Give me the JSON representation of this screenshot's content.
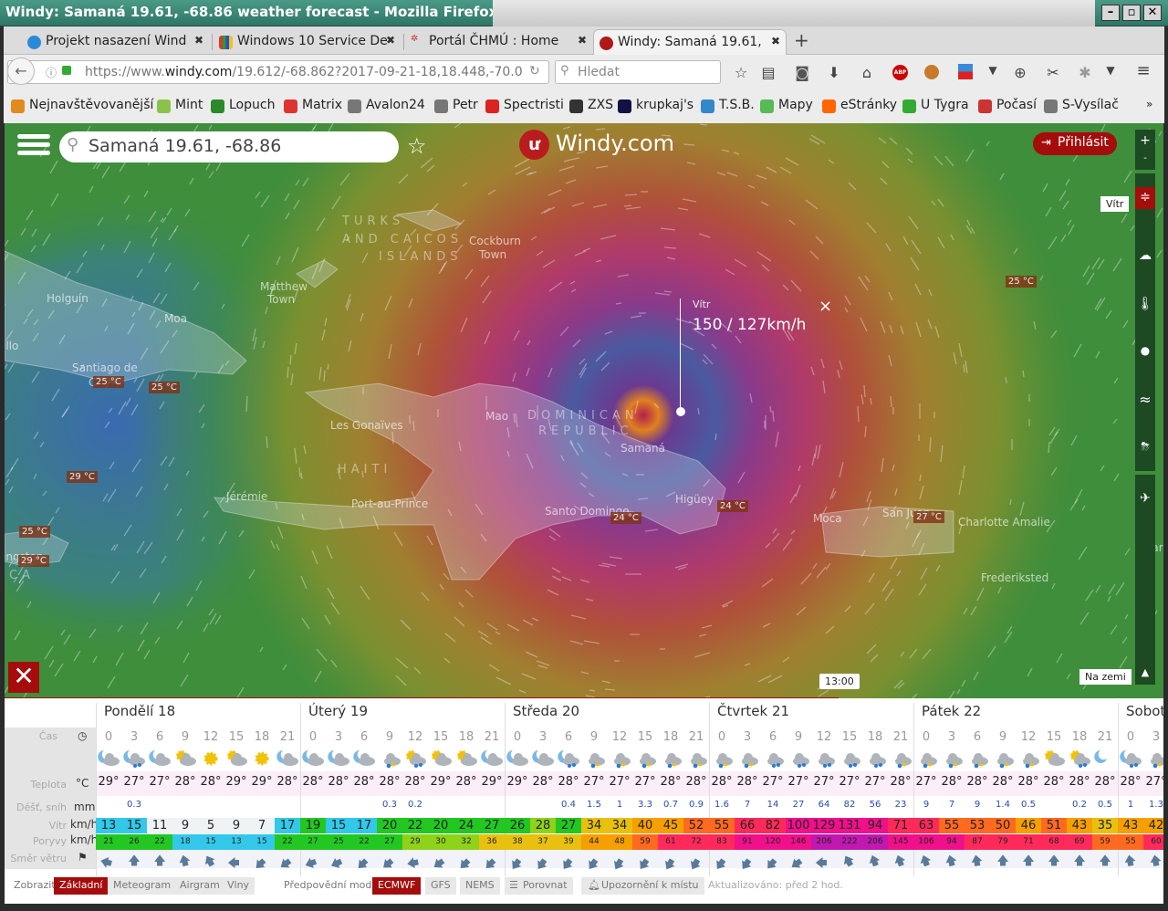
{
  "window": {
    "title": "Windy: Samaná 19.61, -68.86 weather forecast - Mozilla Firefox",
    "minimize": "–",
    "restore": "▫",
    "close": "✕"
  },
  "tabs": [
    {
      "label": "Projekt nasazení Wind",
      "color": "#2a8ad8",
      "active": false
    },
    {
      "label": "Windows 10 Service De",
      "color": "#d83a2a",
      "active": false
    },
    {
      "label": "Portál ČHMÚ : Home",
      "color": "#cc3333",
      "active": false
    },
    {
      "label": "Windy: Samaná 19.61,",
      "color": "#b01818",
      "active": true
    }
  ],
  "new_tab": "+",
  "url": {
    "prefix": "https://www.",
    "domain": "windy.com",
    "path": "/19.612/-68.862?2017-09-21-18,18.448,-70.0"
  },
  "search_placeholder": "Hledat",
  "bookmarks": [
    "Nejnavštěvovanější",
    "Mint",
    "Lopuch",
    "Matrix",
    "Avalon24",
    "Petr",
    "Spectristi",
    "ZXS",
    "krupkaj's",
    "T.S.B.",
    "Mapy",
    "eStránky",
    "U Tygra",
    "Počasí",
    "S-Vysílač"
  ],
  "bookmarks_more": "»",
  "windy": {
    "search_value": "Samaná 19.61, -68.86",
    "logo": "Windy.com",
    "login": "Přihlásit",
    "zoom_in": "+",
    "zoom_out": "-",
    "layer_active": "Vítr",
    "layers": [
      "wind-icon",
      "cloud-icon",
      "thermometer-icon",
      "drop-icon",
      "waves-icon",
      "storm-icon",
      "plane-icon",
      "mountain-icon"
    ],
    "altitude_label": "Na zemi",
    "popup": {
      "title": "Vítr",
      "value": "150 / 127km/h",
      "close": "×"
    },
    "timeline_time": "13:00",
    "timeline_progress": 0.72,
    "accent": "#a50c0c"
  },
  "map": {
    "temps": [
      "25 °C",
      "25 °C",
      "25 °C",
      "29 °C",
      "24 °C",
      "24 °C",
      "27 °C",
      "25 °C",
      "29 °C"
    ],
    "places": [
      "TURKS",
      "AND CAICOS",
      "ISLANDS",
      "Cockburn",
      "Town",
      "Matthew",
      "Town",
      "Holguín",
      "Moa",
      "illo",
      "Santiago de",
      "C",
      "Les Gonaïves",
      "HAITI",
      "Jérémie",
      "Port-au-Prince",
      "Mao",
      "DOMINICAN",
      "REPUBLIC",
      "Samaná",
      "Santo Domingo",
      "Higüey",
      "Moca",
      "San Juan",
      "Charlotte Amalie",
      "Frederiksted",
      "ingston",
      "CA",
      "Mar"
    ]
  },
  "forecast": {
    "row_labels": {
      "time": "Čas",
      "temp": "Teplota",
      "temp_unit": "°C",
      "rain": "Déšť, sníh",
      "rain_unit": "mm",
      "wind": "Vítr",
      "wind_unit": "km/h",
      "gust": "Poryvy",
      "gust_unit": "km/h",
      "dir": "Směr větru"
    },
    "days": [
      {
        "label": "Pondělí 18",
        "hours": [
          "0",
          "3",
          "6",
          "9",
          "12",
          "15",
          "18",
          "21"
        ],
        "icons": [
          "moon-cloud",
          "moon-cloud-rain",
          "moon-cloud",
          "sun-cloud",
          "sun",
          "sun-cloud",
          "sun",
          "moon-cloud"
        ],
        "temps": [
          "29°",
          "27°",
          "27°",
          "28°",
          "28°",
          "29°",
          "29°",
          "28°"
        ],
        "rain": [
          "",
          "0.3",
          "",
          "",
          "",
          "",
          "",
          ""
        ],
        "wind": [
          "13",
          "15",
          "11",
          "9",
          "5",
          "9",
          "7",
          "17"
        ],
        "gusts": [
          "21",
          "26",
          "22",
          "18",
          "15",
          "13",
          "15",
          "22"
        ],
        "dirs": [
          285,
          0,
          0,
          345,
          330,
          270,
          225,
          235
        ]
      },
      {
        "label": "Úterý 19",
        "hours": [
          "0",
          "3",
          "6",
          "9",
          "12",
          "15",
          "18",
          "21"
        ],
        "icons": [
          "moon-cloud",
          "moon-cloud",
          "moon-cloud",
          "cloud-storm",
          "sun-cloud-rain",
          "sun-cloud",
          "sun-cloud",
          "moon-cloud"
        ],
        "temps": [
          "28°",
          "28°",
          "28°",
          "28°",
          "28°",
          "29°",
          "28°",
          "29°"
        ],
        "rain": [
          "",
          "",
          "",
          "0.3",
          "0.2",
          "",
          "",
          ""
        ],
        "wind": [
          "19",
          "15",
          "17",
          "20",
          "22",
          "20",
          "24",
          "27"
        ],
        "gusts": [
          "27",
          "25",
          "22",
          "27",
          "29",
          "30",
          "32",
          "36"
        ],
        "dirs": [
          250,
          245,
          225,
          230,
          260,
          235,
          225,
          225
        ]
      },
      {
        "label": "Středa 20",
        "hours": [
          "0",
          "3",
          "6",
          "9",
          "12",
          "15",
          "18",
          "21"
        ],
        "icons": [
          "moon-cloud",
          "moon-cloud",
          "moon-cloud-rain",
          "cloud-storm",
          "cloud-storm",
          "cloud-storm",
          "cloud-storm",
          "cloud-storm"
        ],
        "temps": [
          "29°",
          "28°",
          "28°",
          "27°",
          "27°",
          "27°",
          "28°",
          "28°"
        ],
        "rain": [
          "",
          "",
          "0.4",
          "1.5",
          "1",
          "3.3",
          "0.7",
          "0.9"
        ],
        "wind": [
          "26",
          "28",
          "27",
          "34",
          "34",
          "40",
          "45",
          "52"
        ],
        "gusts": [
          "38",
          "37",
          "39",
          "44",
          "48",
          "59",
          "61",
          "72"
        ],
        "dirs": [
          215,
          215,
          215,
          215,
          210,
          215,
          210,
          210
        ]
      },
      {
        "label": "Čtvrtek 21",
        "hours": [
          "0",
          "3",
          "6",
          "9",
          "12",
          "15",
          "18",
          "21"
        ],
        "icons": [
          "cloud-storm",
          "cloud-storm",
          "cloud-rain",
          "cloud-rain",
          "cloud-rain",
          "cloud-rain",
          "cloud-rain",
          "cloud-storm"
        ],
        "temps": [
          "28°",
          "28°",
          "27°",
          "27°",
          "27°",
          "27°",
          "27°",
          "28°"
        ],
        "rain": [
          "1.6",
          "7",
          "14",
          "27",
          "64",
          "82",
          "56",
          "23"
        ],
        "wind": [
          "55",
          "66",
          "82",
          "100",
          "129",
          "131",
          "94",
          "71"
        ],
        "gusts": [
          "83",
          "91",
          "120",
          "146",
          "206",
          "222",
          "206",
          "145"
        ],
        "dirs": [
          215,
          215,
          220,
          235,
          270,
          330,
          340,
          340
        ]
      },
      {
        "label": "Pátek 22",
        "hours": [
          "0",
          "3",
          "6",
          "9",
          "12",
          "15",
          "18",
          "21"
        ],
        "icons": [
          "cloud-storm",
          "cloud-storm",
          "cloud-storm",
          "cloud-storm",
          "cloud-storm",
          "sun-cloud",
          "sun-cloud-rain",
          "moon"
        ],
        "temps": [
          "27°",
          "28°",
          "28°",
          "28°",
          "28°",
          "28°",
          "28°",
          "28°"
        ],
        "rain": [
          "9",
          "7",
          "9",
          "1.4",
          "0.5",
          "",
          "0.2",
          "0.5"
        ],
        "wind": [
          "63",
          "55",
          "53",
          "50",
          "46",
          "51",
          "43",
          "35"
        ],
        "gusts": [
          "106",
          "94",
          "87",
          "79",
          "71",
          "68",
          "69",
          "59"
        ],
        "dirs": [
          340,
          345,
          350,
          0,
          0,
          0,
          0,
          0
        ]
      },
      {
        "label": "Sobota",
        "hours": [
          "0",
          "3"
        ],
        "icons": [
          "moon-cloud-rain",
          "cloud-storm"
        ],
        "temps": [
          "28°",
          "27°"
        ],
        "rain": [
          "1",
          "1.3"
        ],
        "wind": [
          "43",
          "42"
        ],
        "gusts": [
          "55",
          "60"
        ],
        "dirs": [
          350,
          350
        ]
      }
    ],
    "bottom": {
      "show_label": "Zobrazit",
      "views": [
        "Základní",
        "Meteogram",
        "Airgram",
        "Vlny"
      ],
      "model_label": "Předpovědní model",
      "models": [
        "ECMWF",
        "GFS",
        "NEMS"
      ],
      "compare": "Porovnat",
      "alert": "Upozornění k místu",
      "updated": "Aktualizováno: před 2 hod."
    }
  }
}
